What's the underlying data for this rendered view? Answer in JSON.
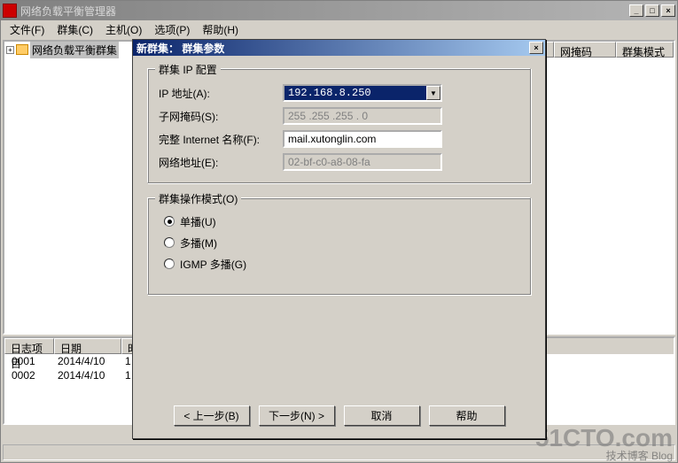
{
  "main_window": {
    "title": "网络负载平衡管理器",
    "menu": {
      "file": "文件(F)",
      "cluster": "群集(C)",
      "host": "主机(O)",
      "options": "选项(P)",
      "help": "帮助(H)"
    },
    "win_min": "_",
    "win_max": "□",
    "win_close": "×",
    "tree_root": "网络负载平衡群集",
    "tree_expand": "+",
    "right_cols": {
      "netmask": "网掩码",
      "mode": "群集模式"
    },
    "log": {
      "cols": {
        "item": "日志项目",
        "date": "日期",
        "time": "时"
      },
      "rows": [
        {
          "id": "0001",
          "date": "2014/4/10",
          "time": "1"
        },
        {
          "id": "0002",
          "date": "2014/4/10",
          "time": "1"
        }
      ]
    }
  },
  "dialog": {
    "title": "新群集：  群集参数",
    "close": "×",
    "group_ip": {
      "legend": "群集 IP 配置",
      "ip_label": "IP 地址(A):",
      "ip_value": "192.168.8.250",
      "subnet_label": "子网掩码(S):",
      "subnet_value": "255 .255 .255 . 0",
      "fqdn_label": "完整 Internet 名称(F):",
      "fqdn_value": "mail.xutonglin.com",
      "mac_label": "网络地址(E):",
      "mac_value": "02-bf-c0-a8-08-fa"
    },
    "group_mode": {
      "legend": "群集操作模式(O)",
      "unicast": "单播(U)",
      "multicast": "多播(M)",
      "igmp": "IGMP 多播(G)"
    },
    "buttons": {
      "back": "< 上一步(B)",
      "next": "下一步(N) >",
      "cancel": "取消",
      "help": "帮助"
    }
  },
  "watermark": {
    "big": "51CTO.com",
    "small": "技术博客  Blog"
  }
}
